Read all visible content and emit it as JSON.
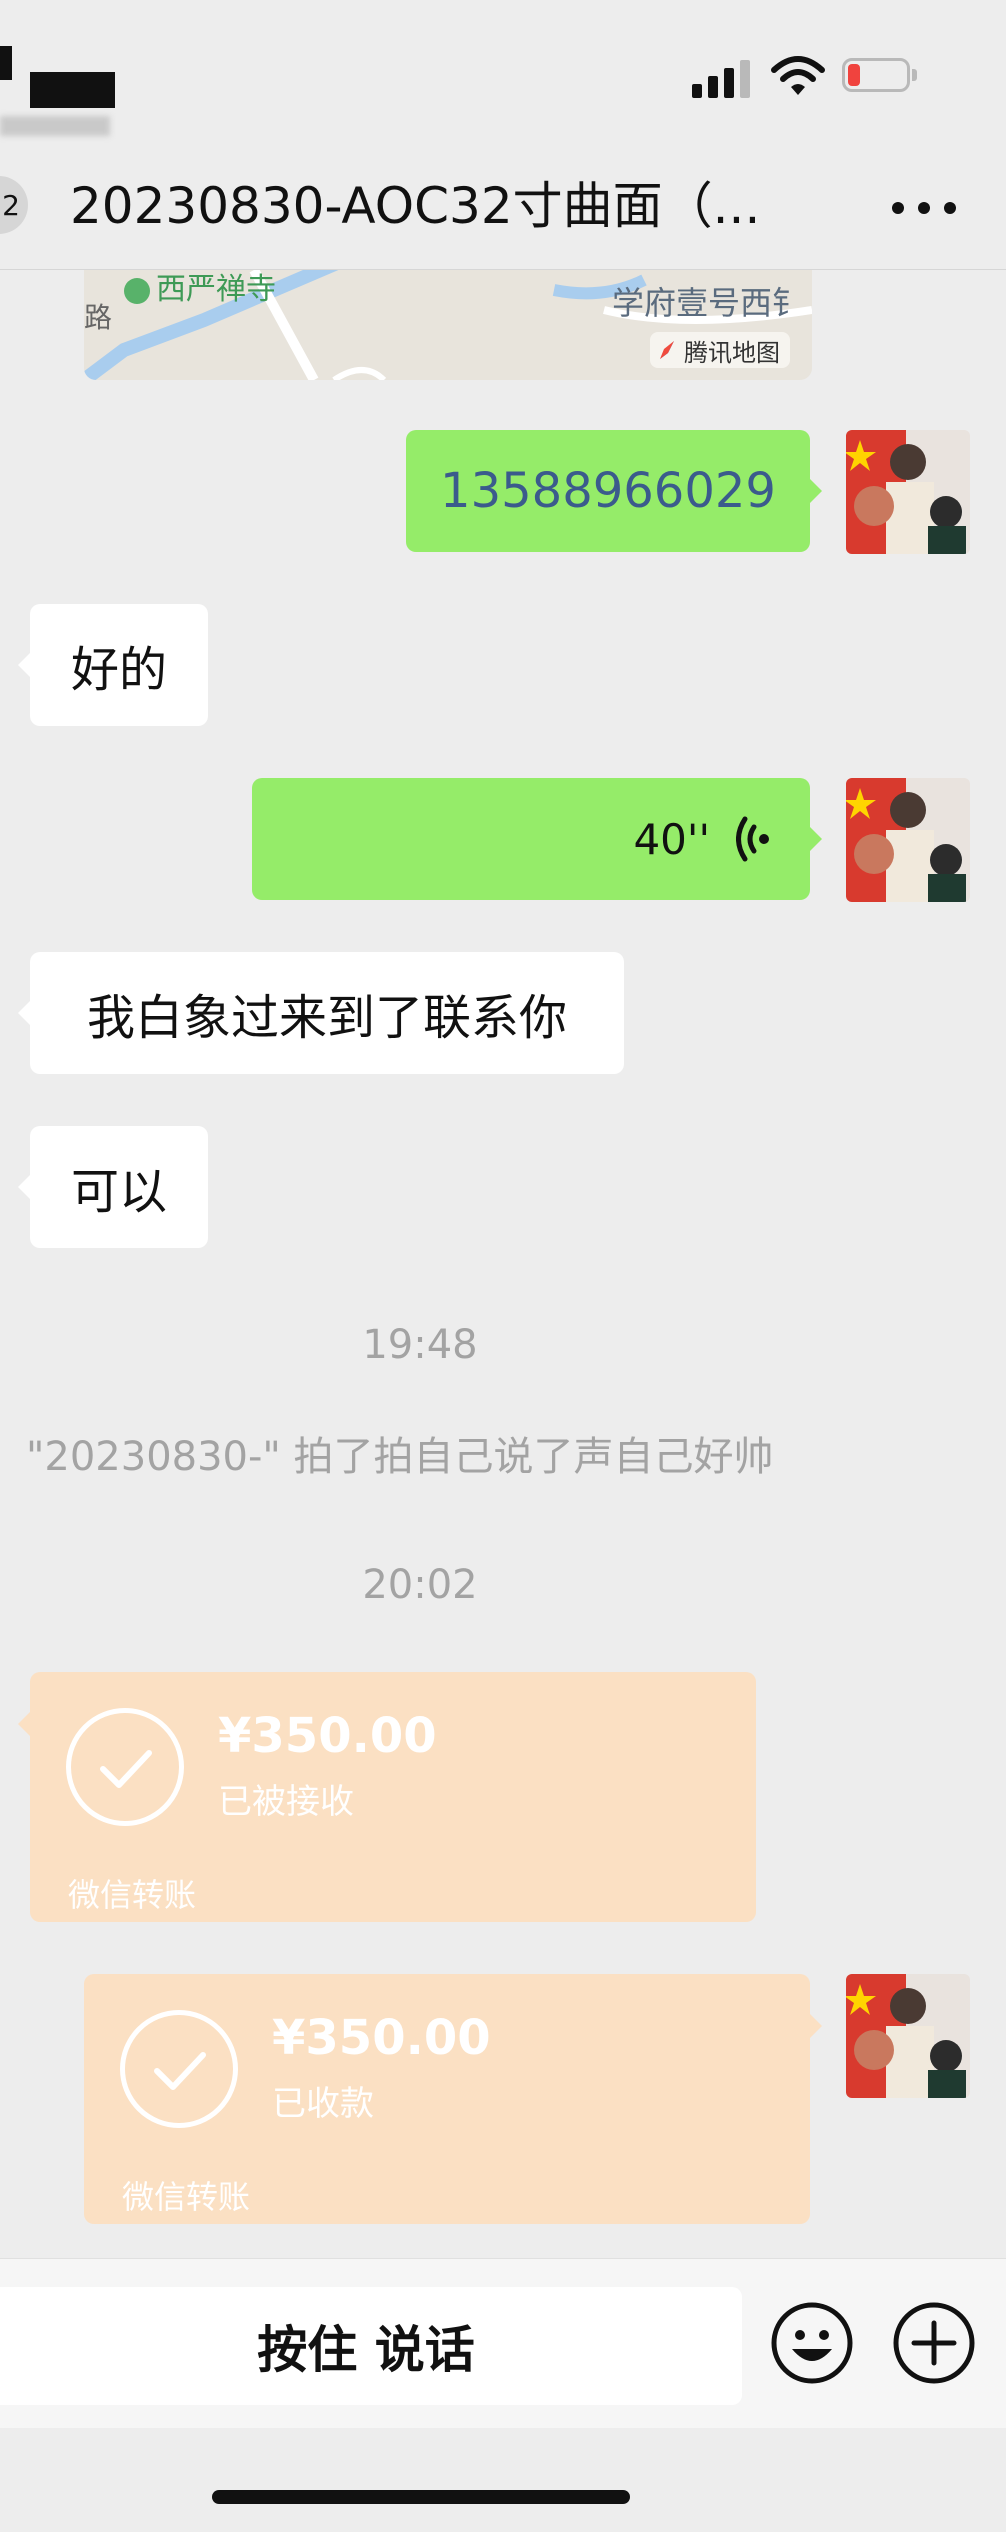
{
  "status_bar": {
    "battery_color": "#f0433e"
  },
  "header": {
    "back_badge": "2",
    "title": "20230830-AOC32寸曲面（..."
  },
  "map": {
    "place_1": "西严禅寺",
    "place_2": "学府壹号西钅",
    "road": "路",
    "provider": "腾讯地图"
  },
  "messages": [
    {
      "side": "right",
      "type": "text",
      "text": "13588966029"
    },
    {
      "side": "left",
      "type": "text",
      "text": "好的"
    },
    {
      "side": "right",
      "type": "voice",
      "text": "40''"
    },
    {
      "side": "left",
      "type": "text",
      "text": "我白象过来到了联系你"
    },
    {
      "side": "left",
      "type": "text",
      "text": "可以"
    }
  ],
  "system": {
    "time_1": "19:48",
    "pat_notice": "\"20230830-\" 拍了拍自己说了声自己好帅",
    "time_2": "20:02"
  },
  "transfers": [
    {
      "side": "left",
      "amount": "¥350.00",
      "status": "已被接收",
      "footer": "微信转账"
    },
    {
      "side": "right",
      "amount": "¥350.00",
      "status": "已收款",
      "footer": "微信转账"
    }
  ],
  "input_bar": {
    "hold_to_talk": "按住 说话"
  },
  "colors": {
    "background": "#ededed",
    "green_bubble": "#95ec69",
    "transfer_card": "#fbe0c3"
  }
}
